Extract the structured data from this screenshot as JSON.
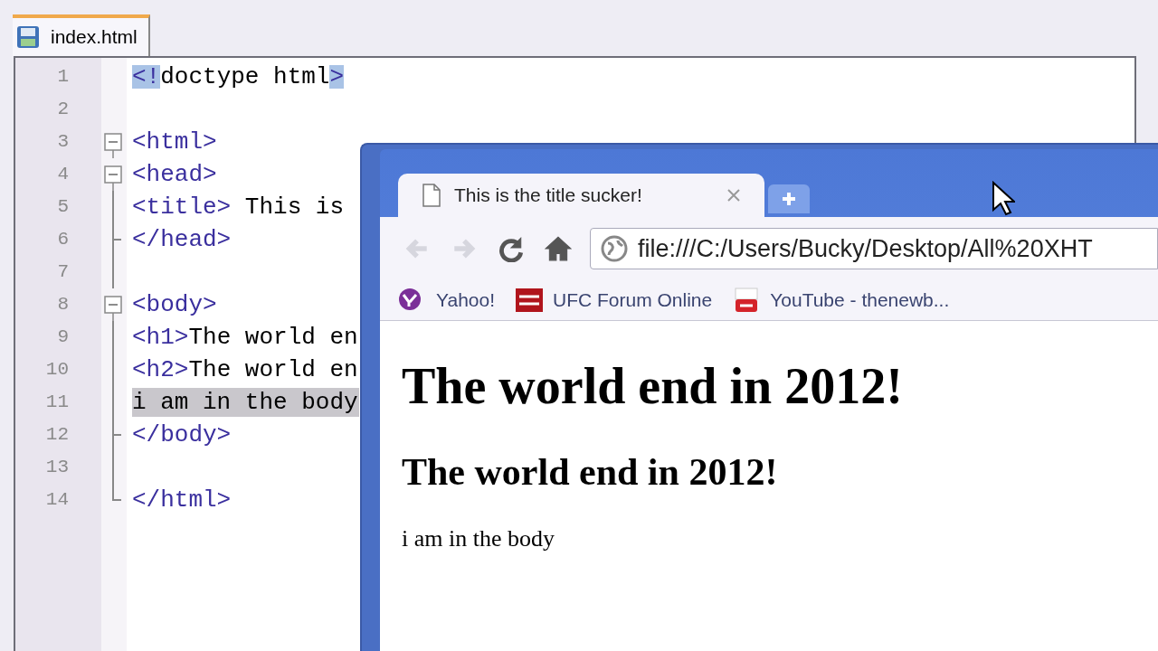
{
  "editor": {
    "tab": {
      "label": "index.html",
      "selected": true
    },
    "lines": [
      {
        "number": "1",
        "kind": "plain",
        "selected": false,
        "parts": [
          {
            "text": "<!",
            "kind": "tag",
            "matched": true
          },
          {
            "text": "doctype html",
            "kind": "text",
            "matched": false
          },
          {
            "text": ">",
            "kind": "tag",
            "matched": true
          }
        ]
      },
      {
        "number": "2",
        "kind": "plain",
        "selected": false
      },
      {
        "number": "3",
        "kind": "open",
        "selected": false,
        "parts": [
          {
            "text": "<html>",
            "kind": "tag",
            "matched": false
          }
        ]
      },
      {
        "number": "4",
        "kind": "open",
        "selected": false,
        "parts": [
          {
            "text": "<head>",
            "kind": "tag",
            "matched": false
          }
        ]
      },
      {
        "number": "5",
        "kind": "line",
        "selected": false,
        "parts": [
          {
            "text": "<title>",
            "kind": "tag",
            "matched": false
          },
          {
            "text": " This is",
            "kind": "text",
            "matched": false
          }
        ]
      },
      {
        "number": "6",
        "kind": "tee",
        "selected": false,
        "parts": [
          {
            "text": "</head>",
            "kind": "tag",
            "matched": false
          }
        ]
      },
      {
        "number": "7",
        "kind": "line",
        "selected": false
      },
      {
        "number": "8",
        "kind": "open",
        "selected": false,
        "parts": [
          {
            "text": "<body>",
            "kind": "tag",
            "matched": false
          }
        ]
      },
      {
        "number": "9",
        "kind": "line",
        "selected": false,
        "parts": [
          {
            "text": "<h1>",
            "kind": "tag",
            "matched": false
          },
          {
            "text": "The world en",
            "kind": "text",
            "matched": false
          }
        ]
      },
      {
        "number": "10",
        "kind": "line",
        "selected": false,
        "parts": [
          {
            "text": "<h2>",
            "kind": "tag",
            "matched": false
          },
          {
            "text": "The world en",
            "kind": "text",
            "matched": false
          }
        ]
      },
      {
        "number": "11",
        "kind": "line",
        "selected": true,
        "parts": [
          {
            "text": "i am in the body",
            "kind": "text",
            "matched": false
          }
        ]
      },
      {
        "number": "12",
        "kind": "tee",
        "selected": false,
        "parts": [
          {
            "text": "</body>",
            "kind": "tag",
            "matched": false
          }
        ]
      },
      {
        "number": "13",
        "kind": "line",
        "selected": false
      },
      {
        "number": "14",
        "kind": "end",
        "selected": false,
        "parts": [
          {
            "text": "</html>",
            "kind": "tag",
            "matched": false
          }
        ]
      }
    ]
  },
  "browser": {
    "tab": {
      "title": "This is the title sucker!"
    },
    "nav": [
      {
        "kind": "back",
        "disabled": true
      },
      {
        "kind": "forward",
        "disabled": true
      },
      {
        "kind": "reload",
        "disabled": false
      },
      {
        "kind": "home",
        "disabled": false
      }
    ],
    "url": "file:///C:/Users/Bucky/Desktop/All%20XHT",
    "bookmarks": [
      {
        "label": "Yahoo!",
        "kind": "yahoo"
      },
      {
        "label": "UFC Forum Online",
        "kind": "ufc"
      },
      {
        "label": "YouTube - thenewb...",
        "kind": "youtube"
      }
    ],
    "page": [
      {
        "kind": "h1",
        "text": "The world end in 2012!"
      },
      {
        "kind": "h2",
        "text": "The world end in 2012!"
      },
      {
        "kind": "p",
        "text": "i am in the body"
      }
    ]
  }
}
